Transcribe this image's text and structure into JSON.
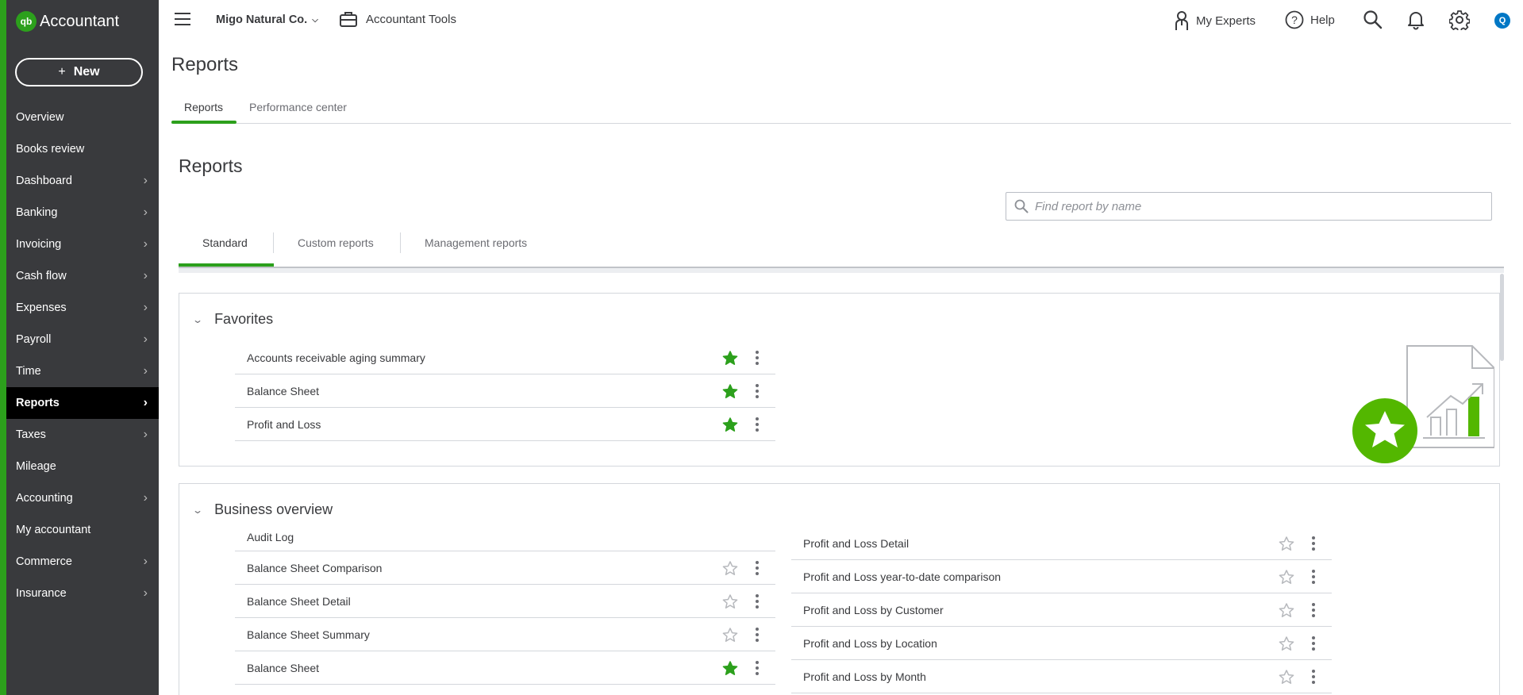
{
  "brand": {
    "logo_text": "qb",
    "name": "Accountant"
  },
  "sidebar": {
    "new_label": "New",
    "new_plus": "+",
    "items": [
      {
        "label": "Overview",
        "has_chevron": false
      },
      {
        "label": "Books review",
        "has_chevron": false
      },
      {
        "label": "Dashboard",
        "has_chevron": true
      },
      {
        "label": "Banking",
        "has_chevron": true
      },
      {
        "label": "Invoicing",
        "has_chevron": true
      },
      {
        "label": "Cash flow",
        "has_chevron": true
      },
      {
        "label": "Expenses",
        "has_chevron": true
      },
      {
        "label": "Payroll",
        "has_chevron": true
      },
      {
        "label": "Time",
        "has_chevron": true
      },
      {
        "label": "Reports",
        "has_chevron": true,
        "active": true
      },
      {
        "label": "Taxes",
        "has_chevron": true
      },
      {
        "label": "Mileage",
        "has_chevron": false
      },
      {
        "label": "Accounting",
        "has_chevron": true
      },
      {
        "label": "My accountant",
        "has_chevron": false
      },
      {
        "label": "Commerce",
        "has_chevron": true
      },
      {
        "label": "Insurance",
        "has_chevron": true
      }
    ]
  },
  "topbar": {
    "company": "Migo Natural Co.",
    "accountant_tools": "Accountant Tools",
    "my_experts": "My Experts",
    "help": "Help",
    "avatar_initial": "Q"
  },
  "page": {
    "title": "Reports",
    "tabs": [
      "Reports",
      "Performance center"
    ],
    "active_tab": "Reports",
    "section_title": "Reports",
    "search_placeholder": "Find report by name",
    "sub_tabs": [
      "Standard",
      "Custom reports",
      "Management reports"
    ],
    "active_sub_tab": "Standard"
  },
  "favorites": {
    "title": "Favorites",
    "items": [
      {
        "name": "Accounts receivable aging summary",
        "starred": true
      },
      {
        "name": "Balance Sheet",
        "starred": true
      },
      {
        "name": "Profit and Loss",
        "starred": true
      }
    ]
  },
  "business_overview": {
    "title": "Business overview",
    "left": [
      {
        "name": "Audit Log",
        "starred": null
      },
      {
        "name": "Balance Sheet Comparison",
        "starred": false
      },
      {
        "name": "Balance Sheet Detail",
        "starred": false
      },
      {
        "name": "Balance Sheet Summary",
        "starred": false
      },
      {
        "name": "Balance Sheet",
        "starred": true
      }
    ],
    "right": [
      {
        "name": "Profit and Loss Detail",
        "starred": false
      },
      {
        "name": "Profit and Loss year-to-date comparison",
        "starred": false
      },
      {
        "name": "Profit and Loss by Customer",
        "starred": false
      },
      {
        "name": "Profit and Loss by Location",
        "starred": false
      },
      {
        "name": "Profit and Loss by Month",
        "starred": false
      }
    ]
  },
  "colors": {
    "accent": "#2ca01c",
    "sidebar": "#393a3d",
    "text": "#393a3d",
    "link_blue": "#0077c5"
  }
}
